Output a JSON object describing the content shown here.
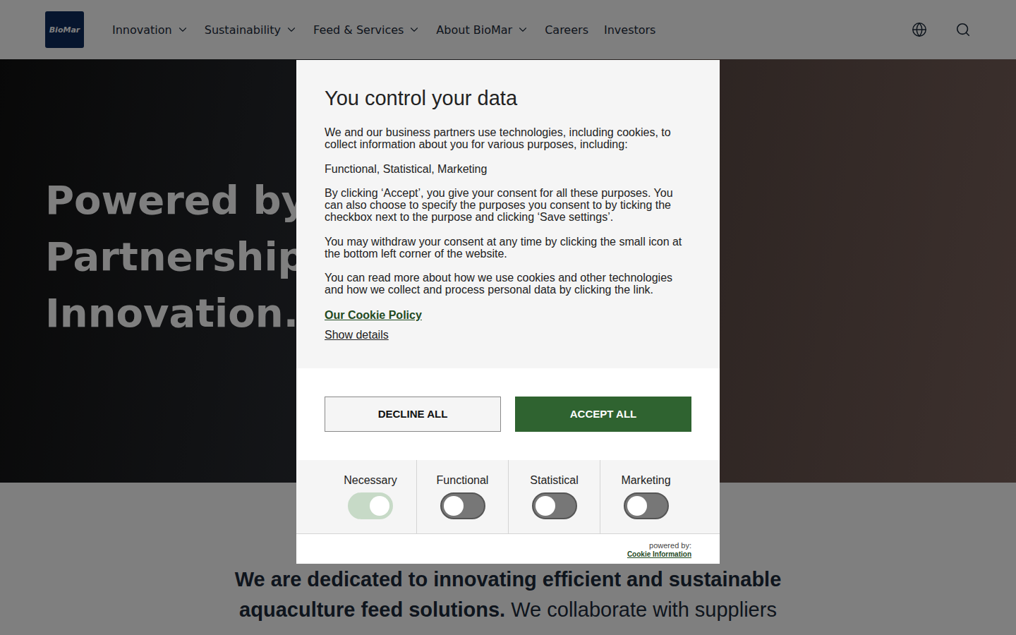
{
  "header": {
    "logo": "BioMar",
    "nav": [
      {
        "label": "Innovation",
        "dropdown": true
      },
      {
        "label": "Sustainability",
        "dropdown": true
      },
      {
        "label": "Feed & Services",
        "dropdown": true
      },
      {
        "label": "About BioMar",
        "dropdown": true
      },
      {
        "label": "Careers",
        "dropdown": false
      },
      {
        "label": "Investors",
        "dropdown": false
      }
    ]
  },
  "hero": {
    "lines": [
      "Powered by",
      "Partnership.",
      "Innovation."
    ]
  },
  "intro": {
    "bold": "We are dedicated to innovating efficient and sustainable aquaculture feed solutions.",
    "text": "We collaborate with suppliers"
  },
  "dialog": {
    "title": "You control your data",
    "paragraphs": [
      "We and our business partners use technologies, including cookies, to collect information about you for various purposes, including:",
      "Functional, Statistical, Marketing",
      "By clicking ‘Accept’, you give your consent for all these purposes. You can also choose to specify the purposes you consent to by ticking the checkbox next to the purpose and clicking ‘Save settings’.",
      "You may withdraw your consent at any time by clicking the small icon at the bottom left corner of the website.",
      "You can read more about how we use cookies and other technologies and how we collect and process personal data by clicking the link."
    ],
    "policy_link": "Our Cookie Policy",
    "details_link": "Show details",
    "buttons": [
      {
        "label": "DECLINE ALL",
        "kind": "outline"
      },
      {
        "label": "ACCEPT ALL",
        "kind": "primary"
      }
    ],
    "categories": [
      {
        "label": "Necessary",
        "on": true,
        "disabled": true
      },
      {
        "label": "Functional",
        "on": false,
        "disabled": false
      },
      {
        "label": "Statistical",
        "on": false,
        "disabled": false
      },
      {
        "label": "Marketing",
        "on": false,
        "disabled": false
      }
    ],
    "footer": {
      "powered": "powered by:",
      "brand": "Cookie Information"
    }
  }
}
